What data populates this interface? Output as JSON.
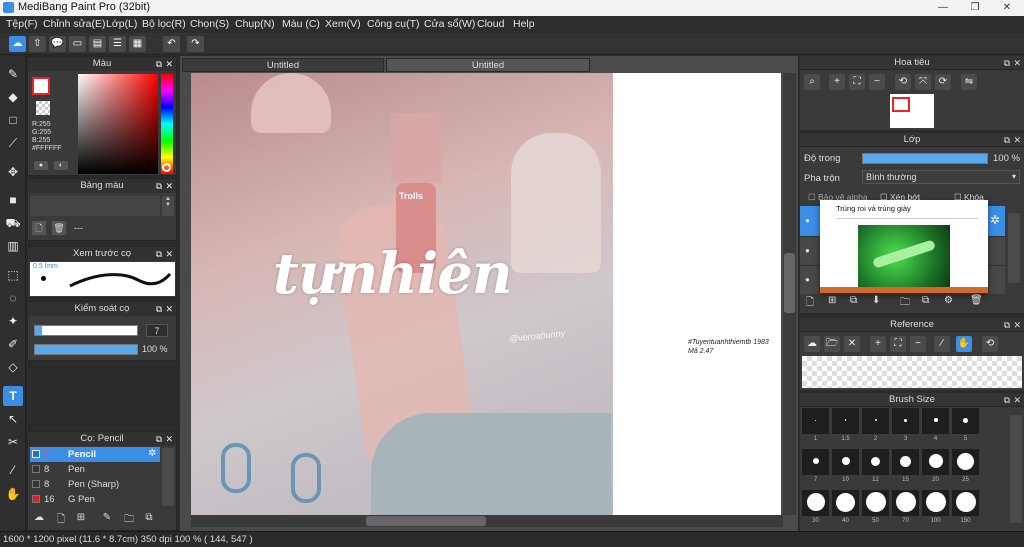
{
  "window": {
    "title": "MediBang Paint Pro (32bit)",
    "minimize": "—",
    "restore": "❐",
    "close": "✕"
  },
  "menu": [
    "Tệp(F)",
    "Chỉnh sửa(E)",
    "Lớp(L)",
    "Bộ lọc(R)",
    "Chọn(S)",
    "Chụp(N)",
    "Màu (C)",
    "Xem(V)",
    "Công cụ(T)",
    "Cửa sổ(W)",
    "Cloud",
    "Help"
  ],
  "tabs": [
    "Untitled",
    "Untitled"
  ],
  "panels": {
    "color": {
      "title": "Màu",
      "readout": [
        "R:255",
        "G:255",
        "B:255",
        "#FFFFFF"
      ]
    },
    "palette": {
      "title": "Bảng màu",
      "footer": "---"
    },
    "preview": {
      "title": "Xem trước cọ",
      "size": "0.5 lmm"
    },
    "brush_control": {
      "title": "Kiểm soát cọ",
      "size_value": "7",
      "opacity_value": "100 %",
      "size_fill": 0.07,
      "opacity_fill": 1.0
    },
    "brush": {
      "title": "Cọ: Pencil",
      "items": [
        {
          "size": "7",
          "name": "Pencil",
          "active": true,
          "color": "#2d6fb3"
        },
        {
          "size": "8",
          "name": "Pen",
          "active": false,
          "color": "#333333"
        },
        {
          "size": "8",
          "name": "Pen (Sharp)",
          "active": false,
          "color": "#333333"
        },
        {
          "size": "16",
          "name": "G Pen",
          "active": false,
          "color": "#e02020"
        }
      ]
    }
  },
  "canvas": {
    "title_text": "tựnhiên",
    "watermark": "@veroabunny",
    "can_label": "Trolls",
    "note_line1": "#Tuyentuanhthiemtb 1983",
    "note_line2": "Mã 2.47"
  },
  "right": {
    "navigator": {
      "title": "Hoa tiêu"
    },
    "layer": {
      "title": "Lớp",
      "opacity_label": "Độ trong",
      "opacity_value": "100 %",
      "opacity_fill": 1.0,
      "blend_label": "Pha trộn",
      "blend_value": "Bình thường",
      "checks": [
        "Bảo vệ alpha",
        "Xén bớt",
        "Khóa"
      ],
      "popup_title": "Trùng roi và trùng giày"
    },
    "reference": {
      "title": "Reference"
    },
    "brush_size": {
      "title": "Brush Size",
      "labels": [
        "1",
        "1.5",
        "2",
        "3",
        "4",
        "5",
        "7",
        "10",
        "12",
        "15",
        "20",
        "25",
        "30",
        "40",
        "50",
        "70",
        "100",
        "150"
      ]
    }
  },
  "status": {
    "text": "1600 * 1200 pixel   (11.6 * 8.7cm)   350 dpi   100 %   ( 144, 547 )"
  },
  "colors": {
    "accent": "#3a8ee6",
    "panel": "#3a3a3a",
    "bg": "#2b2b2b"
  }
}
